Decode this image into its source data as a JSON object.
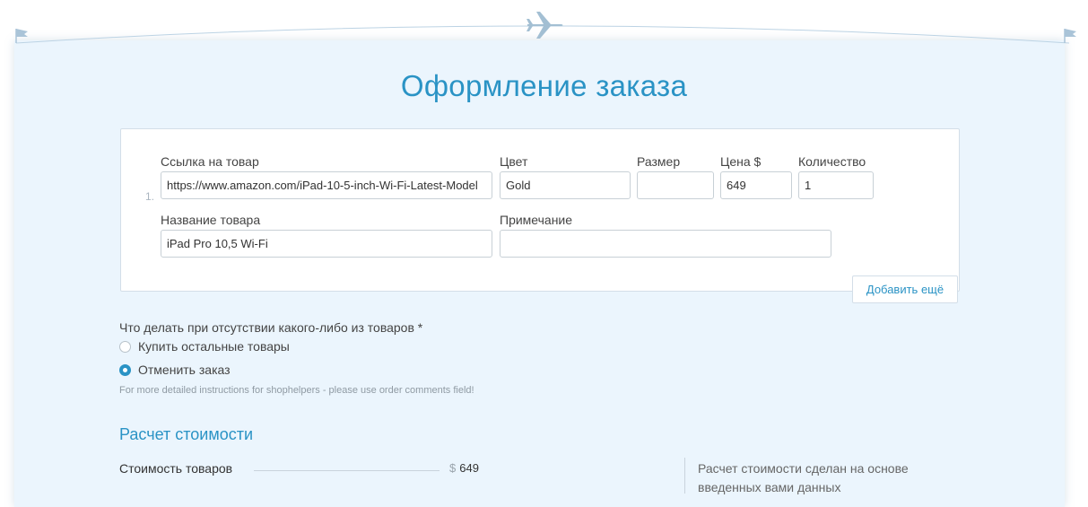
{
  "page": {
    "title": "Оформление заказа"
  },
  "item": {
    "index": "1.",
    "link_label": "Ссылка на товар",
    "link_value": "https://www.amazon.com/iPad-10-5-inch-Wi-Fi-Latest-Model",
    "color_label": "Цвет",
    "color_value": "Gold",
    "size_label": "Размер",
    "size_value": "",
    "price_label": "Цена $",
    "price_value": "649",
    "qty_label": "Количество",
    "qty_value": "1",
    "name_label": "Название товара",
    "name_value": "iPad Pro 10,5 Wi-Fi",
    "note_label": "Примечание",
    "note_value": ""
  },
  "add_more_label": "Добавить ещё",
  "missing": {
    "question": "Что делать при отсутствии какого-либо из товаров *",
    "options": [
      {
        "label": "Купить остальные товары",
        "selected": false
      },
      {
        "label": "Отменить заказ",
        "selected": true
      }
    ],
    "hint": "For more detailed instructions for shophelpers - please use order comments field!"
  },
  "calc": {
    "title": "Расчет стоимости",
    "goods_label": "Стоимость товаров",
    "currency": "$",
    "goods_value": "649",
    "note": "Расчет стоимости сделан на основе введенных вами данных"
  },
  "icons": {
    "top_center": "airplane-icon",
    "corners": "flag-icon"
  },
  "colors": {
    "accent": "#2a93c5",
    "card_bg": "#ebf5fd"
  }
}
